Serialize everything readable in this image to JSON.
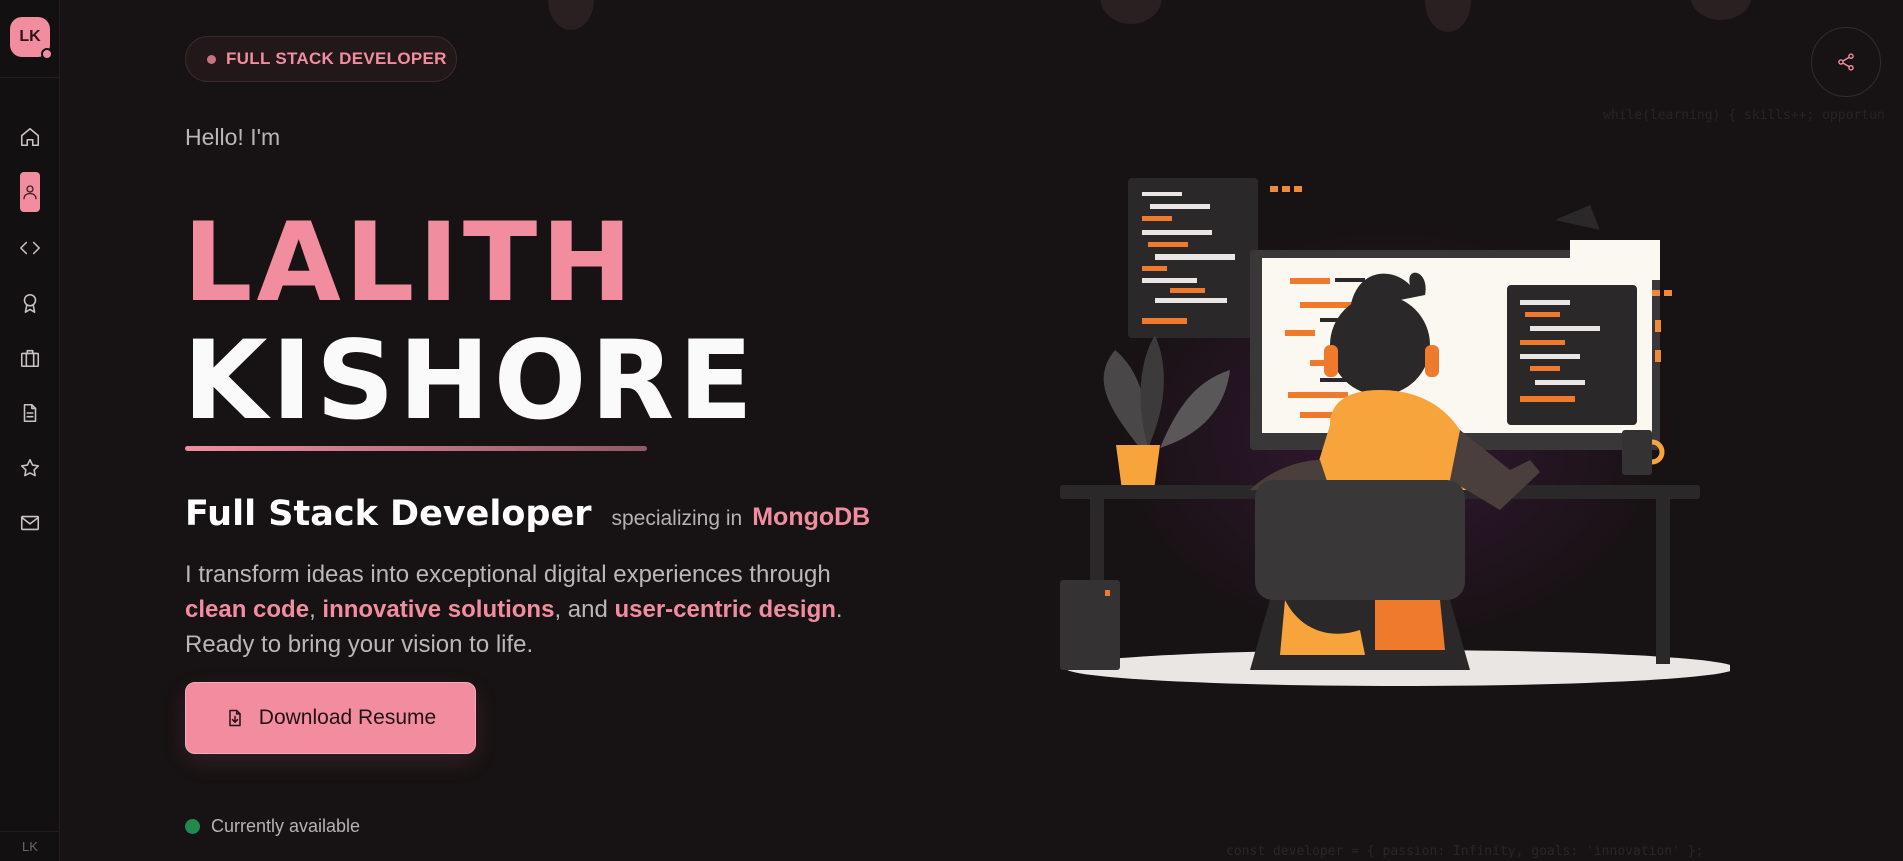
{
  "sidebar": {
    "logo_text": "LK",
    "footer_text": "LK",
    "items": [
      {
        "name": "home",
        "icon": "home-icon",
        "active": false
      },
      {
        "name": "about",
        "icon": "user-icon",
        "active": true
      },
      {
        "name": "projects",
        "icon": "code-icon",
        "active": false
      },
      {
        "name": "achievements",
        "icon": "award-icon",
        "active": false
      },
      {
        "name": "experience",
        "icon": "briefcase-icon",
        "active": false
      },
      {
        "name": "resume",
        "icon": "document-icon",
        "active": false
      },
      {
        "name": "skills",
        "icon": "star-icon",
        "active": false
      },
      {
        "name": "contact",
        "icon": "mail-icon",
        "active": false
      }
    ]
  },
  "hero": {
    "badge": "FULL STACK DEVELOPER",
    "greeting": "Hello! I'm",
    "first_name": "LALITH",
    "last_name": "KISHORE",
    "role_title": "Full Stack Developer",
    "role_specializing": "specializing in",
    "role_tech": "MongoDB",
    "description": {
      "p1": "I transform ideas into exceptional digital experiences through ",
      "h1": "clean code",
      "p2": ", ",
      "h2": "innovative solutions",
      "p3": ", and ",
      "h3": "user-centric design",
      "p4": ". Ready to bring your vision to life."
    },
    "download_label": "Download Resume",
    "status_text": "Currently available"
  },
  "header": {
    "share_icon": "share-icon"
  },
  "decor": {
    "code_top": "while(learning) { skills++; opportun",
    "code_bottom": "const developer = { passion: Infinity, goals: 'innovation' };"
  },
  "colors": {
    "accent": "#f28da0",
    "background": "#171213",
    "status_available": "#1f8a4c",
    "illustration_orange": "#fa9a3c"
  }
}
